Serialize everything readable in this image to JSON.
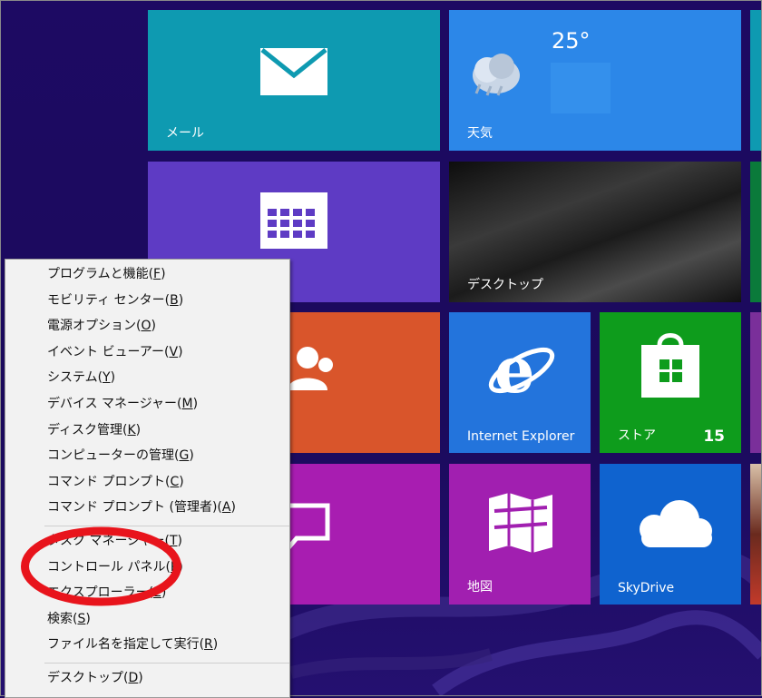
{
  "tiles": {
    "mail": {
      "label": "メール",
      "color": "#0e9ab1"
    },
    "weather": {
      "label": "天気",
      "temperature": "25°",
      "color": "#2c87e8"
    },
    "calendar": {
      "label": "",
      "color": "#5e3bc4"
    },
    "desktop": {
      "label": "デスクトップ",
      "color": "#1a1a1a"
    },
    "people": {
      "label": "",
      "color": "#d9552b"
    },
    "ie": {
      "label": "Internet Explorer",
      "color": "#2374dc"
    },
    "store": {
      "label": "ストア",
      "badge": "15",
      "color": "#0e9c1c"
    },
    "messaging": {
      "label": "",
      "color": "#a81db1"
    },
    "maps": {
      "label": "地図",
      "color": "#a11fb0"
    },
    "skydrive": {
      "label": "SkyDrive",
      "color": "#0f63cf"
    }
  },
  "context_menu": {
    "groups": [
      [
        {
          "text": "プログラムと機能(",
          "key": "F",
          "close": ")"
        },
        {
          "text": "モビリティ センター(",
          "key": "B",
          "close": ")"
        },
        {
          "text": "電源オプション(",
          "key": "O",
          "close": ")"
        },
        {
          "text": "イベント ビューアー(",
          "key": "V",
          "close": ")"
        },
        {
          "text": "システム(",
          "key": "Y",
          "close": ")"
        },
        {
          "text": "デバイス マネージャー(",
          "key": "M",
          "close": ")"
        },
        {
          "text": "ディスク管理(",
          "key": "K",
          "close": ")"
        },
        {
          "text": "コンピューターの管理(",
          "key": "G",
          "close": ")"
        },
        {
          "text": "コマンド プロンプト(",
          "key": "C",
          "close": ")"
        },
        {
          "text": "コマンド プロンプト (管理者)(",
          "key": "A",
          "close": ")"
        }
      ],
      [
        {
          "text": "タスク マネージャー(",
          "key": "T",
          "close": ")"
        },
        {
          "text": "コントロール パネル(",
          "key": "P",
          "close": ")"
        },
        {
          "text": "エクスプローラー(",
          "key": "E",
          "close": ")"
        },
        {
          "text": "検索(",
          "key": "S",
          "close": ")"
        },
        {
          "text": "ファイル名を指定して実行(",
          "key": "R",
          "close": ")"
        }
      ],
      [
        {
          "text": "デスクトップ(",
          "key": "D",
          "close": ")"
        }
      ]
    ]
  },
  "highlight": {
    "target": "コントロール パネル",
    "color": "#e8141c"
  }
}
